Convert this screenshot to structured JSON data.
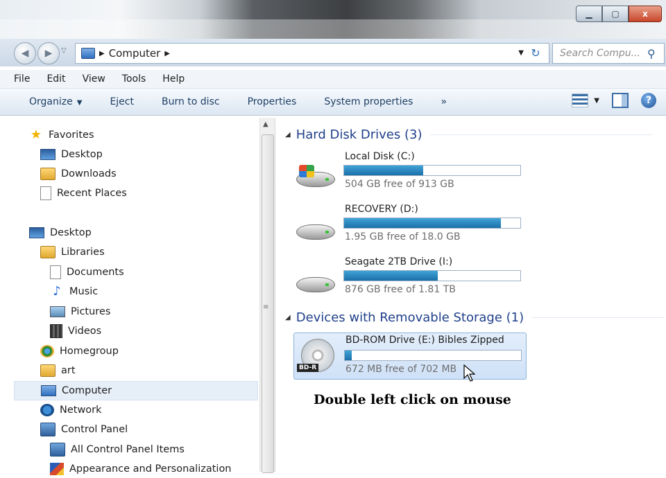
{
  "window": {
    "controls": [
      "minimize-icon",
      "maximize-icon",
      "close-icon"
    ],
    "close_glyph": "x"
  },
  "address": {
    "path": [
      "Computer"
    ],
    "search_placeholder": "Search Compu..."
  },
  "menu": [
    "File",
    "Edit",
    "View",
    "Tools",
    "Help"
  ],
  "commands": {
    "organize": "Organize",
    "eject": "Eject",
    "burn": "Burn to disc",
    "properties": "Properties",
    "system_properties": "System properties",
    "more": "»"
  },
  "nav": {
    "favorites": "Favorites",
    "fav_desktop": "Desktop",
    "downloads": "Downloads",
    "recent": "Recent Places",
    "desktop": "Desktop",
    "libraries": "Libraries",
    "documents": "Documents",
    "music": "Music",
    "pictures": "Pictures",
    "videos": "Videos",
    "homegroup": "Homegroup",
    "art": "art",
    "computer": "Computer",
    "network": "Network",
    "control_panel": "Control Panel",
    "all_cp_items": "All Control Panel Items",
    "appearance": "Appearance and Personalization"
  },
  "groups": {
    "hdd": "Hard Disk Drives (3)",
    "removable": "Devices with Removable Storage (1)"
  },
  "drives": [
    {
      "name": "Local Disk (C:)",
      "free": "504 GB free of 913 GB",
      "used_fraction": 0.45
    },
    {
      "name": "RECOVERY (D:)",
      "free": "1.95 GB free of 18.0 GB",
      "used_fraction": 0.89
    },
    {
      "name": "Seagate 2TB Drive (I:)",
      "free": "876 GB free of 1.81 TB",
      "used_fraction": 0.53
    },
    {
      "name": "BD-ROM Drive (E:) Bibles Zipped",
      "free": "672 MB free of 702 MB",
      "used_fraction": 0.04,
      "badge": "BD-R"
    }
  ],
  "caption": "Double left click on mouse",
  "colors": {
    "accent": "#1e3f8a",
    "bar": "#1b6fa8",
    "selection": "#cfe1f7"
  }
}
